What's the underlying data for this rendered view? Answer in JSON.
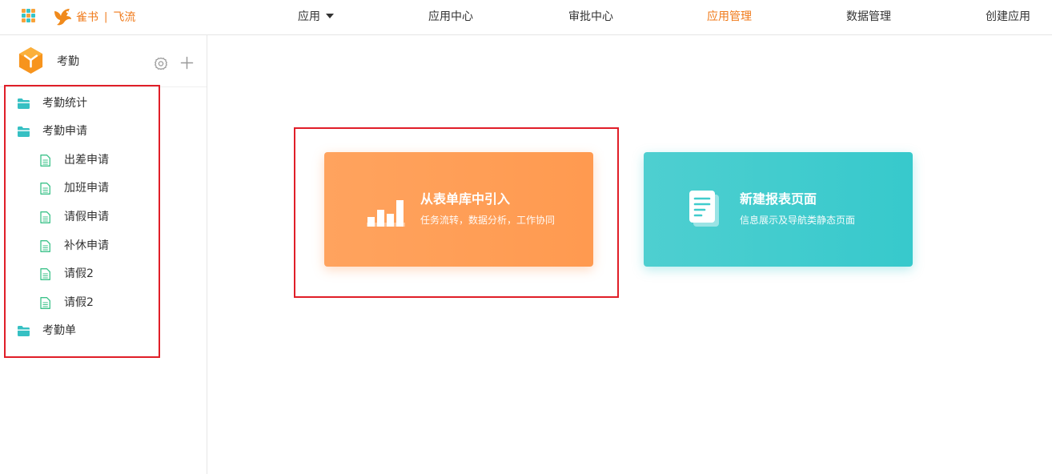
{
  "header": {
    "brand_name": "雀书",
    "brand_separator": "|",
    "brand_product": "飞流",
    "nav": [
      {
        "label": "应用",
        "has_dropdown": true
      },
      {
        "label": "应用中心"
      },
      {
        "label": "审批中心"
      },
      {
        "label": "应用管理",
        "active": true
      },
      {
        "label": "数据管理"
      },
      {
        "label": "创建应用"
      }
    ],
    "accent_color": "#f07a1a"
  },
  "sidebar": {
    "app_name": "考勤",
    "tree": [
      {
        "label": "考勤统计",
        "type": "folder"
      },
      {
        "label": "考勤申请",
        "type": "folder"
      },
      {
        "label": "出差申请",
        "type": "form"
      },
      {
        "label": "加班申请",
        "type": "form"
      },
      {
        "label": "请假申请",
        "type": "form"
      },
      {
        "label": "补休申请",
        "type": "form"
      },
      {
        "label": "请假2",
        "type": "form"
      },
      {
        "label": "请假2",
        "type": "form"
      },
      {
        "label": "考勤单",
        "type": "folder"
      }
    ]
  },
  "main": {
    "cards": [
      {
        "title": "从表单库中引入",
        "subtitle": "任务流转，数据分析，工作协同",
        "icon": "bar-chart-icon",
        "color": "#ff9d55"
      },
      {
        "title": "新建报表页面",
        "subtitle": "信息展示及导航类静态页面",
        "icon": "report-page-icon",
        "color": "#40cccd"
      }
    ]
  },
  "annotation_color": "#e01e28"
}
